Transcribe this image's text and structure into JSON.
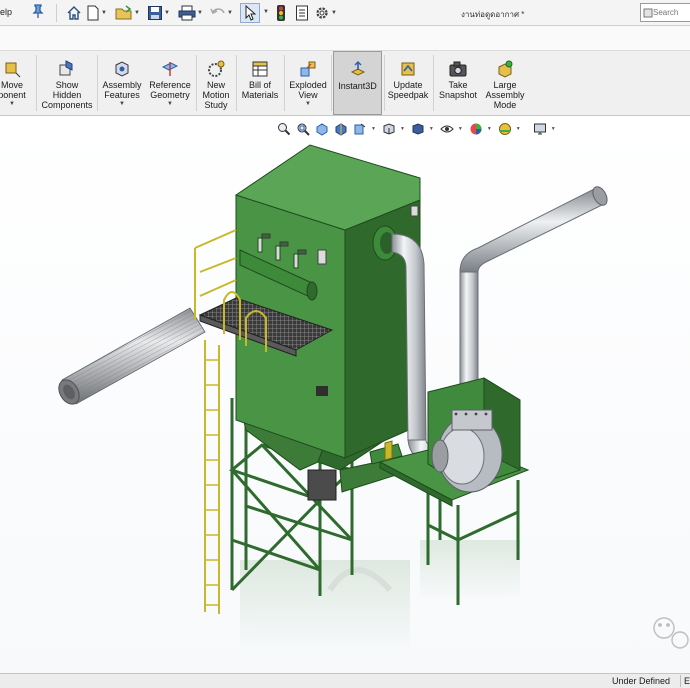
{
  "app": {
    "menu_help": "elp",
    "document_title": "งานท่อดูดอากาศ *",
    "search_placeholder": "Search"
  },
  "quick_access": [
    {
      "name": "home-icon"
    },
    {
      "name": "new-document-icon"
    },
    {
      "name": "open-folder-icon"
    },
    {
      "name": "save-icon"
    },
    {
      "name": "print-icon"
    },
    {
      "name": "undo-icon"
    },
    {
      "name": "select-cursor-icon"
    },
    {
      "name": "rebuild-traffic-light-icon"
    },
    {
      "name": "file-properties-icon"
    },
    {
      "name": "options-gear-icon"
    }
  ],
  "ribbon": {
    "move_component": "Move\nponent",
    "show_hidden": "Show\nHidden\nComponents",
    "assembly_features": "Assembly\nFeatures",
    "reference_geometry": "Reference\nGeometry",
    "new_motion_study": "New\nMotion\nStudy",
    "bill_of_materials": "Bill of\nMaterials",
    "exploded_view": "Exploded\nView",
    "instant3d": "Instant3D",
    "update_speedpak": "Update\nSpeedpak",
    "take_snapshot": "Take\nSnapshot",
    "large_assembly_mode": "Large\nAssembly\nMode"
  },
  "status": {
    "state": "Under Defined",
    "right_clip": "E"
  },
  "colors": {
    "housing_green": "#3f8a3c",
    "ladder_yellow": "#e8d84a",
    "pipe_silver": "#c8ccd2",
    "instant3d_active": "#d4d4d4"
  }
}
